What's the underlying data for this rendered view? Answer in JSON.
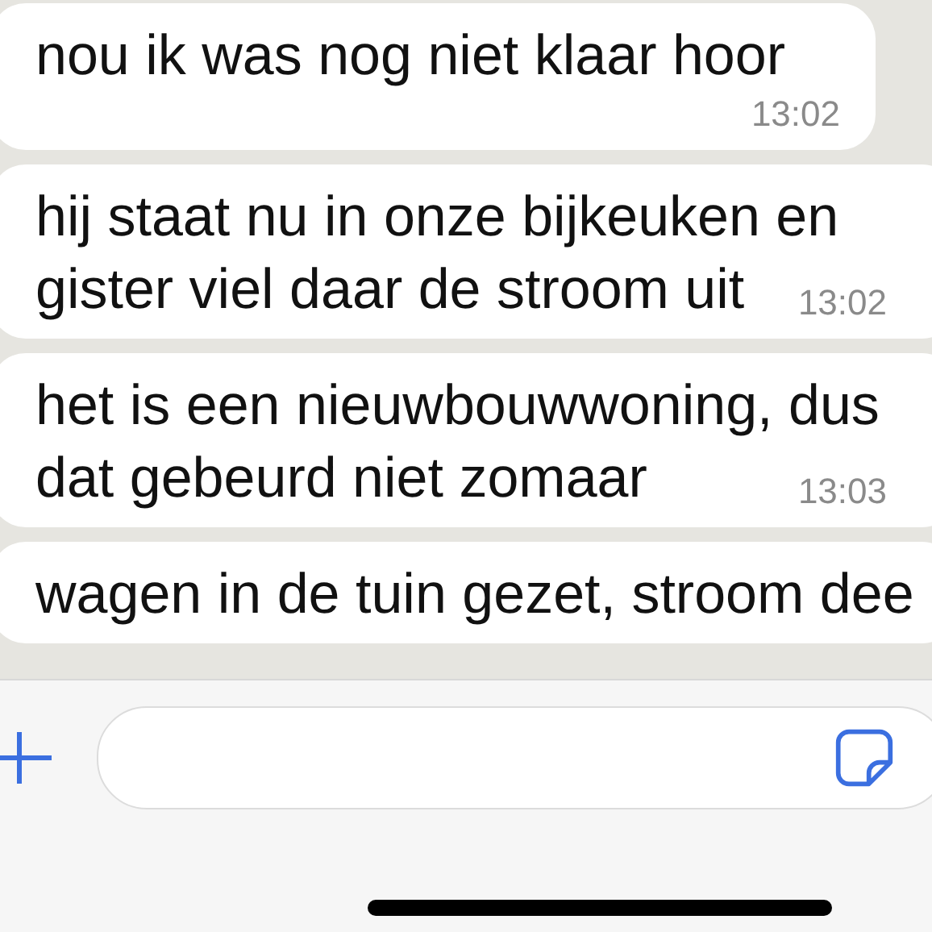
{
  "messages": [
    {
      "lines": [
        "nou ik was nog niet klaar hoor"
      ],
      "time": "13:02"
    },
    {
      "lines": [
        "hij staat nu in onze bijkeuken en",
        "gister viel daar de stroom uit"
      ],
      "time": "13:02"
    },
    {
      "lines": [
        "het is een nieuwbouwwoning, dus",
        "dat gebeurd niet zomaar"
      ],
      "time": "13:03"
    },
    {
      "lines": [
        "wagen in de tuin gezet, stroom dee"
      ]
    }
  ]
}
